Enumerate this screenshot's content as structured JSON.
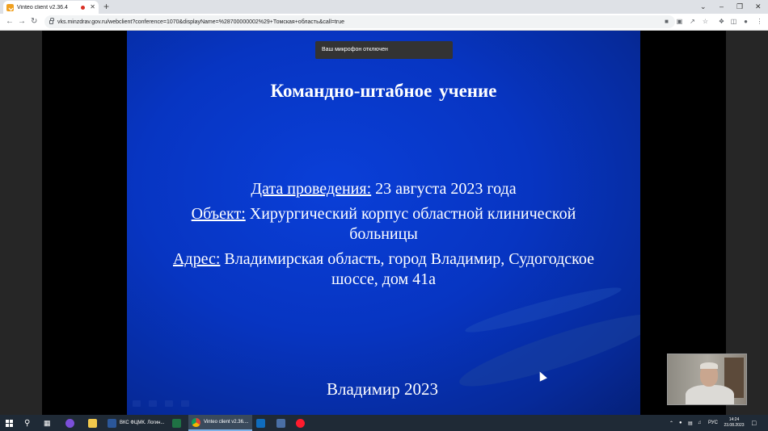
{
  "browser": {
    "tab_title": "Vinteo client v2.36.4",
    "tab_close": "✕",
    "new_tab": "+",
    "url": "vks.minzdrav.gov.ru/webclient?conference=1070&displayName=%28700000002%29+Томская+область&call=true"
  },
  "window_controls": {
    "chevron": "⌄",
    "minimize": "–",
    "restore": "❐",
    "close": "✕"
  },
  "notification": {
    "text": "Ваш микрофон отключен"
  },
  "slide": {
    "title": "Командно-штабное  учение",
    "date_label": "Дата проведения:",
    "date_value": " 23 августа 2023 года",
    "object_label": "Объект:",
    "object_value_1": " Хирургический корпус областной клинической",
    "object_value_2": "больницы",
    "address_label": "Адрес:",
    "address_value_1": " Владимирская область, город Владимир, Судогодское",
    "address_value_2": "шоссе, дом 41а",
    "footer": "Владимир 2023"
  },
  "taskbar": {
    "apps": [
      {
        "label": "ВКС ФЦМК. Логин..."
      },
      {
        "label": "Vinteo client v2.36...."
      }
    ],
    "tray": {
      "lang": "РУС"
    },
    "clock": {
      "time": "14:24",
      "date": "23.08.2023"
    }
  },
  "colors": {
    "slide_blue": "#0735c2",
    "taskbar": "#1f2a36",
    "recording_dot": "#d93025"
  }
}
